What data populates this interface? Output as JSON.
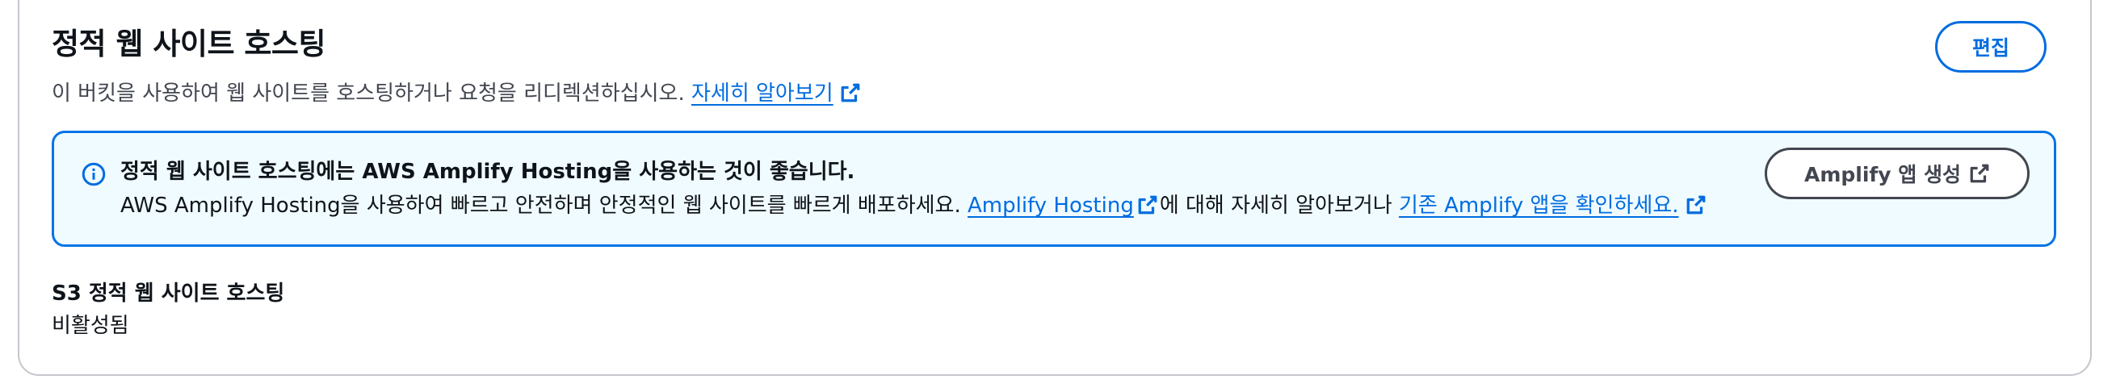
{
  "header": {
    "title": "정적 웹 사이트 호스팅",
    "description": "이 버킷을 사용하여 웹 사이트를 호스팅하거나 요청을 리디렉션하십시오.",
    "learn_more_link": "자세히 알아보기",
    "edit_label": "편집"
  },
  "alert": {
    "heading": "정적 웹 사이트 호스팅에는 AWS Amplify Hosting을 사용하는 것이 좋습니다.",
    "body_prefix": "AWS Amplify Hosting을 사용하여 빠르고 안전하며 안정적인 웹 사이트를 빠르게 배포하세요.",
    "amplify_hosting_link": "Amplify Hosting",
    "body_middle": "에 대해 자세히 알아보거나",
    "existing_apps_link": "기존 Amplify 앱을 확인하세요.",
    "create_app_label": "Amplify 앱 생성"
  },
  "field": {
    "label": "S3 정적 웹 사이트 호스팅",
    "value": "비활성됨"
  },
  "colors": {
    "link": "#006ce0",
    "alert_border": "#0073e6",
    "alert_background": "#f0fbff",
    "panel_border": "#c6c6cd"
  },
  "icons": {
    "external": "external-link-icon",
    "info": "info-icon"
  }
}
